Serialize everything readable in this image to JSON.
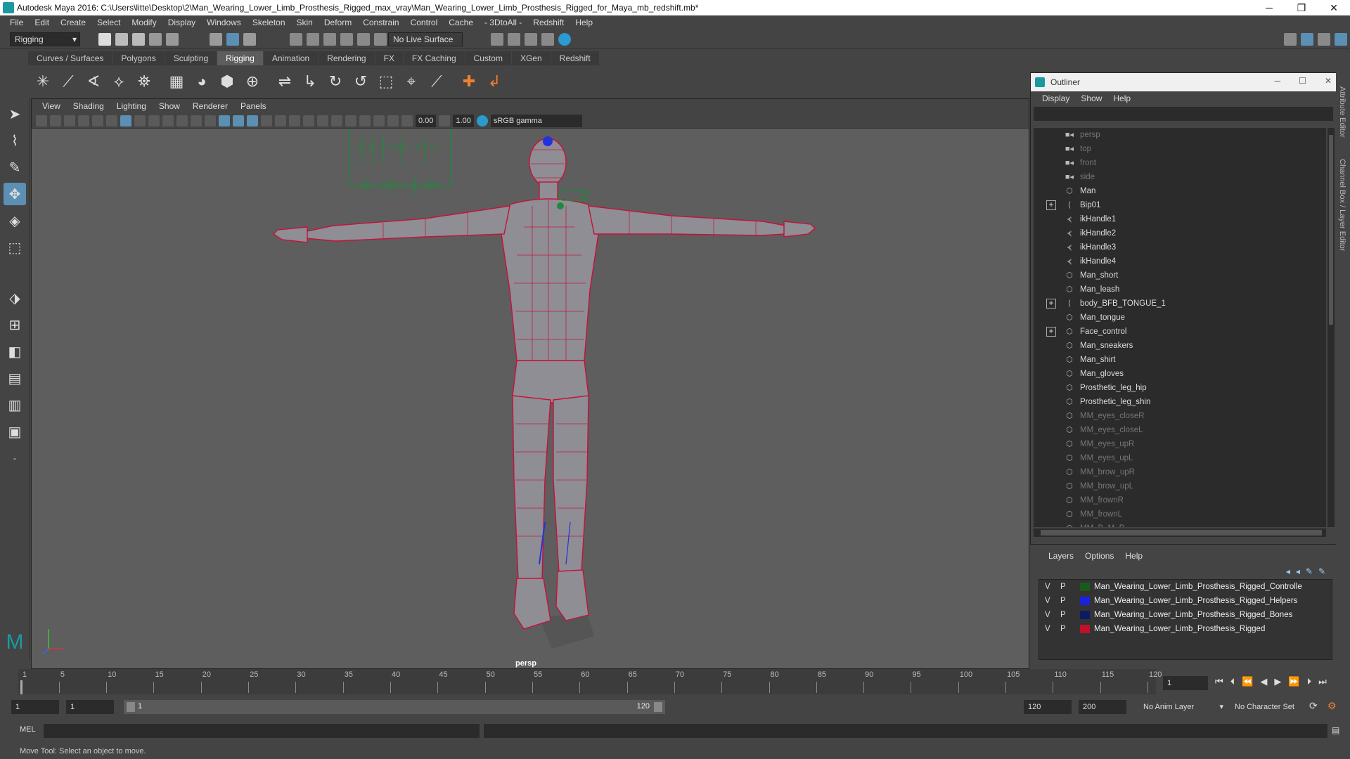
{
  "window": {
    "title": "Autodesk Maya 2016: C:\\Users\\litte\\Desktop\\2\\Man_Wearing_Lower_Limb_Prosthesis_Rigged_max_vray\\Man_Wearing_Lower_Limb_Prosthesis_Rigged_for_Maya_mb_redshift.mb*",
    "minimize": "─",
    "maximize": "❐",
    "close": "✕"
  },
  "menubar": [
    "File",
    "Edit",
    "Create",
    "Select",
    "Modify",
    "Display",
    "Windows",
    "Skeleton",
    "Skin",
    "Deform",
    "Constrain",
    "Control",
    "Cache",
    "- 3DtoAll -",
    "Redshift",
    "Help"
  ],
  "statusline": {
    "mode": "Rigging",
    "live_surface": "No Live Surface"
  },
  "shelf_tabs": [
    "Curves / Surfaces",
    "Polygons",
    "Sculpting",
    "Rigging",
    "Animation",
    "Rendering",
    "FX",
    "FX Caching",
    "Custom",
    "XGen",
    "Redshift"
  ],
  "active_shelf_tab": "Rigging",
  "shelf_icons": [
    "joint-tool-icon",
    "ik-handle-icon",
    "ik-spline-icon",
    "insert-joint-icon",
    "mirror-joint-icon",
    "bind-skin-icon",
    "smooth-bind-icon",
    "lattice-icon",
    "cluster-icon",
    "paint-weights-icon",
    "orient-joint-icon",
    "aim-constraint-icon",
    "point-constraint-icon",
    "scale-constraint-icon",
    "parent-constraint-icon",
    "pole-vector-icon",
    "constraint-a-icon",
    "constraint-b-icon"
  ],
  "viewport": {
    "menu": [
      "View",
      "Shading",
      "Lighting",
      "Show",
      "Renderer",
      "Panels"
    ],
    "exposure": "0.00",
    "gamma": "1.00",
    "color_space": "sRGB gamma",
    "camera": "persp",
    "face_panel": {
      "row1": [
        "O",
        "I-E",
        "U",
        "B-M-P",
        "D-S-T-Z"
      ],
      "row2": [
        "F-V",
        "Ch-Sh-J",
        "Th",
        "Q-W"
      ]
    }
  },
  "outliner": {
    "title": "Outliner",
    "menu": [
      "Display",
      "Show",
      "Help"
    ],
    "items": [
      {
        "label": "persp",
        "icon": "camera-icon",
        "dim": true,
        "expand": false
      },
      {
        "label": "top",
        "icon": "camera-icon",
        "dim": true,
        "expand": false
      },
      {
        "label": "front",
        "icon": "camera-icon",
        "dim": true,
        "expand": false
      },
      {
        "label": "side",
        "icon": "camera-icon",
        "dim": true,
        "expand": false
      },
      {
        "label": "Man",
        "icon": "mesh-icon",
        "dim": false,
        "expand": false
      },
      {
        "label": "Bip01",
        "icon": "joint-icon",
        "dim": false,
        "expand": true
      },
      {
        "label": "ikHandle1",
        "icon": "ik-icon",
        "dim": false,
        "expand": false
      },
      {
        "label": "ikHandle2",
        "icon": "ik-icon",
        "dim": false,
        "expand": false
      },
      {
        "label": "ikHandle3",
        "icon": "ik-icon",
        "dim": false,
        "expand": false
      },
      {
        "label": "ikHandle4",
        "icon": "ik-icon",
        "dim": false,
        "expand": false
      },
      {
        "label": "Man_short",
        "icon": "mesh-icon",
        "dim": false,
        "expand": false
      },
      {
        "label": "Man_leash",
        "icon": "mesh-icon",
        "dim": false,
        "expand": false
      },
      {
        "label": "body_BFB_TONGUE_1",
        "icon": "joint-icon",
        "dim": false,
        "expand": true
      },
      {
        "label": "Man_tongue",
        "icon": "mesh-icon",
        "dim": false,
        "expand": false
      },
      {
        "label": "Face_control",
        "icon": "mesh-icon",
        "dim": false,
        "expand": true
      },
      {
        "label": "Man_sneakers",
        "icon": "mesh-icon",
        "dim": false,
        "expand": false
      },
      {
        "label": "Man_shirt",
        "icon": "mesh-icon",
        "dim": false,
        "expand": false
      },
      {
        "label": "Man_gloves",
        "icon": "mesh-icon",
        "dim": false,
        "expand": false
      },
      {
        "label": "Prosthetic_leg_hip",
        "icon": "mesh-icon",
        "dim": false,
        "expand": false
      },
      {
        "label": "Prosthetic_leg_shin",
        "icon": "mesh-icon",
        "dim": false,
        "expand": false
      },
      {
        "label": "MM_eyes_closeR",
        "icon": "mesh-icon",
        "dim": true,
        "expand": false
      },
      {
        "label": "MM_eyes_closeL",
        "icon": "mesh-icon",
        "dim": true,
        "expand": false
      },
      {
        "label": "MM_eyes_upR",
        "icon": "mesh-icon",
        "dim": true,
        "expand": false
      },
      {
        "label": "MM_eyes_upL",
        "icon": "mesh-icon",
        "dim": true,
        "expand": false
      },
      {
        "label": "MM_brow_upR",
        "icon": "mesh-icon",
        "dim": true,
        "expand": false
      },
      {
        "label": "MM_brow_upL",
        "icon": "mesh-icon",
        "dim": true,
        "expand": false
      },
      {
        "label": "MM_frownR",
        "icon": "mesh-icon",
        "dim": true,
        "expand": false
      },
      {
        "label": "MM_frownL",
        "icon": "mesh-icon",
        "dim": true,
        "expand": false
      },
      {
        "label": "MM_B_M_P",
        "icon": "mesh-icon",
        "dim": true,
        "expand": false
      }
    ]
  },
  "layers": {
    "menu": [
      "Layers",
      "Options",
      "Help"
    ],
    "rows": [
      {
        "v": "V",
        "p": "P",
        "color": "#1a5a1a",
        "name": "Man_Wearing_Lower_Limb_Prosthesis_Rigged_Controlle"
      },
      {
        "v": "V",
        "p": "P",
        "color": "#1a22dd",
        "name": "Man_Wearing_Lower_Limb_Prosthesis_Rigged_Helpers"
      },
      {
        "v": "V",
        "p": "P",
        "color": "#0d1a66",
        "name": "Man_Wearing_Lower_Limb_Prosthesis_Rigged_Bones"
      },
      {
        "v": "V",
        "p": "P",
        "color": "#c0102a",
        "name": "Man_Wearing_Lower_Limb_Prosthesis_Rigged"
      }
    ]
  },
  "timeline": {
    "ticks": [
      "1",
      "5",
      "10",
      "15",
      "20",
      "25",
      "30",
      "35",
      "40",
      "45",
      "50",
      "55",
      "60",
      "65",
      "70",
      "75",
      "80",
      "85",
      "90",
      "95",
      "100",
      "105",
      "110",
      "115",
      "120"
    ],
    "current_frame": "1"
  },
  "range": {
    "start": "1",
    "anim_start": "1",
    "slider_start": "1",
    "slider_end": "120",
    "end": "120",
    "anim_end": "200",
    "anim_layer": "No Anim Layer",
    "char_set": "No Character Set"
  },
  "mel": {
    "label": "MEL"
  },
  "help_line": "Move Tool: Select an object to move.",
  "side_tabs": [
    "Attribute Editor",
    "Channel Box / Layer Editor"
  ]
}
